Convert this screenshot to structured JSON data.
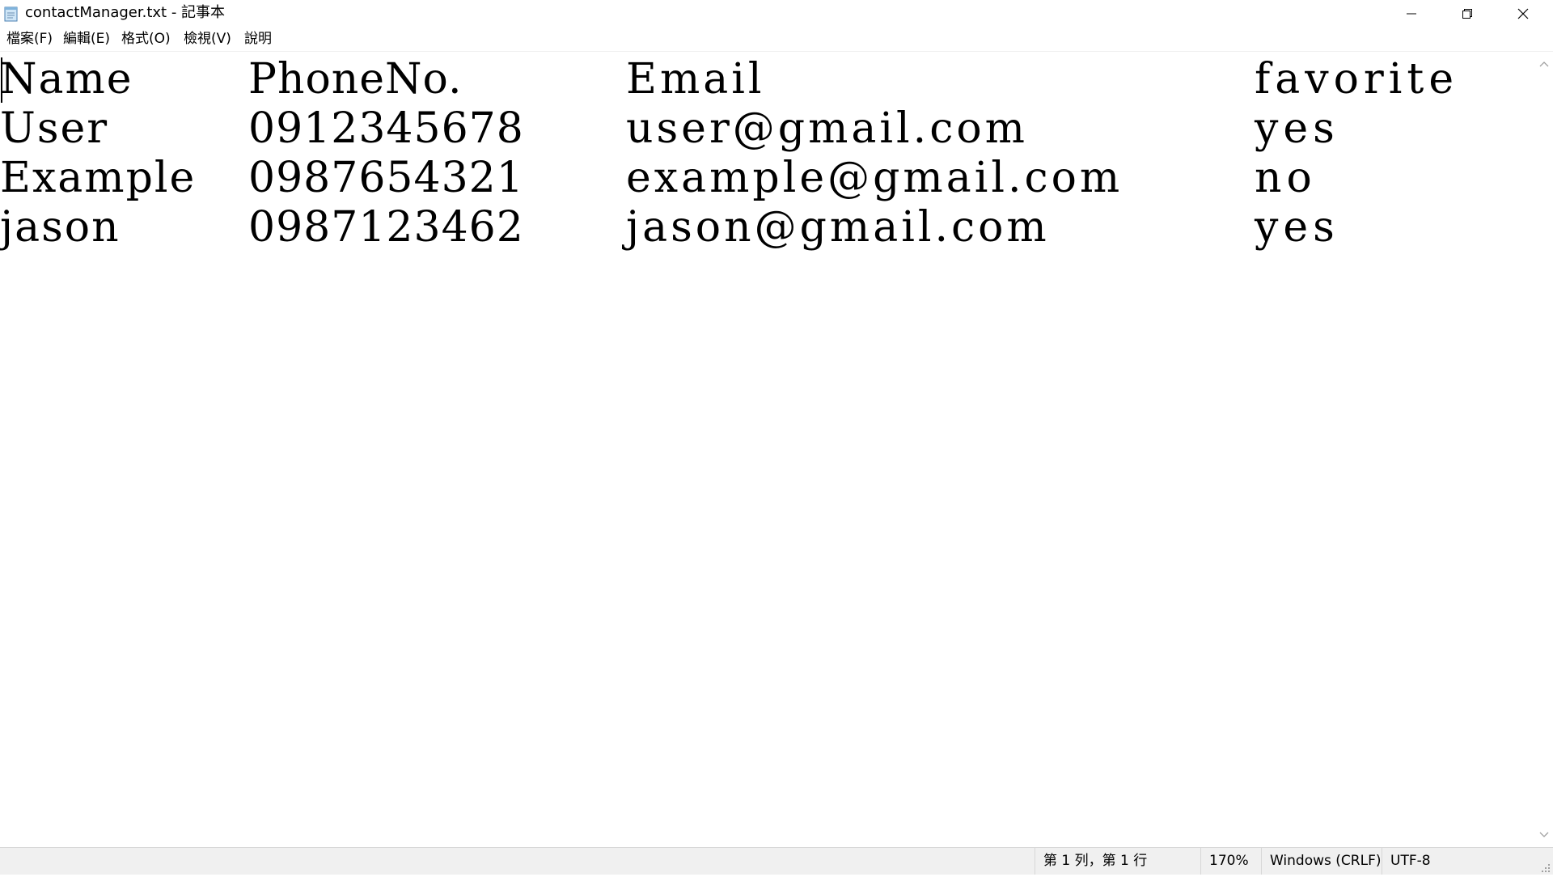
{
  "window": {
    "title": "contactManager.txt - 記事本",
    "app_icon": "notepad-icon",
    "controls": {
      "minimize_icon": "minimize-icon",
      "maximize_icon": "restore-icon",
      "close_icon": "close-icon"
    }
  },
  "menu": {
    "items": [
      {
        "label": "檔案(F)"
      },
      {
        "label": "編輯(E)"
      },
      {
        "label": "格式(O)"
      },
      {
        "label": "檢視(V)"
      },
      {
        "label": "說明"
      }
    ]
  },
  "document": {
    "rows": [
      {
        "name": "Name",
        "phone": "PhoneNo.",
        "email": "Email",
        "favorite": "favorite"
      },
      {
        "name": "User",
        "phone": "0912345678",
        "email": "user@gmail.com",
        "favorite": "yes"
      },
      {
        "name": "Example",
        "phone": "0987654321",
        "email": "example@gmail.com",
        "favorite": "no"
      },
      {
        "name": "jason",
        "phone": "0987123462",
        "email": "jason@gmail.com",
        "favorite": "yes"
      }
    ]
  },
  "status": {
    "position": "第 1 列，第 1 行",
    "zoom": "170%",
    "line_ending": "Windows (CRLF)",
    "encoding": "UTF-8"
  }
}
